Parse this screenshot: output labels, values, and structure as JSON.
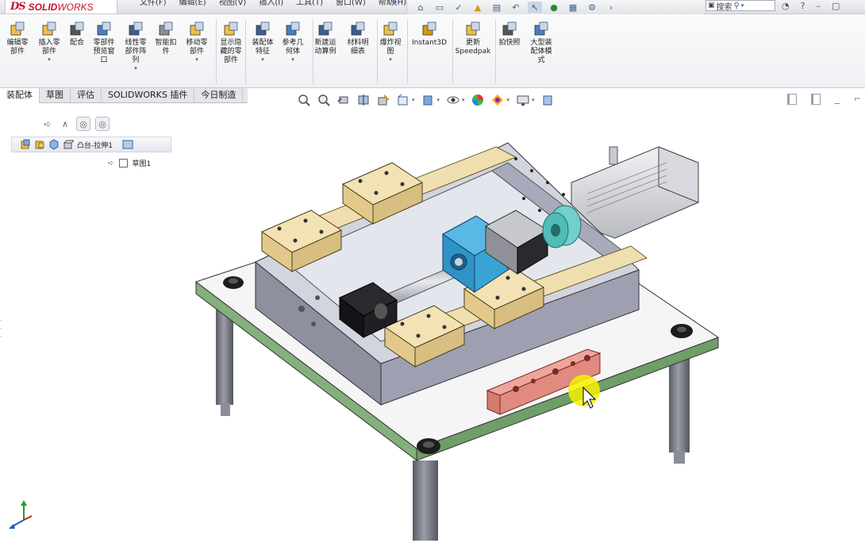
{
  "app": {
    "brand_ds": "DS",
    "brand_name_a": "SOLID",
    "brand_name_b": "WORKS"
  },
  "menu": [
    "文件(F)",
    "编辑(E)",
    "视图(V)",
    "插入(I)",
    "工具(T)",
    "窗口(W)",
    "帮助(H)"
  ],
  "search": {
    "placeholder": "搜索"
  },
  "ribbon": {
    "tools": [
      {
        "name": "edit-component",
        "label": "编辑零\n部件"
      },
      {
        "name": "insert-component",
        "label": "插入零\n部件",
        "dropdown": true
      },
      {
        "name": "mate",
        "label": "配合"
      },
      {
        "name": "component-preview",
        "label": "零部件\n预览窗\n口"
      },
      {
        "name": "linear-pattern",
        "label": "线性零\n部件阵\n列",
        "dropdown": true
      },
      {
        "name": "smart-fasteners",
        "label": "智能扣\n件"
      },
      {
        "name": "move-component",
        "label": "移动零\n部件",
        "dropdown": true
      },
      {
        "name": "show-hidden",
        "label": "显示隐\n藏的零\n部件"
      },
      {
        "name": "assembly-feature",
        "label": "装配体\n特征",
        "dropdown": true
      },
      {
        "name": "reference-geometry",
        "label": "参考几\n何体",
        "dropdown": true
      },
      {
        "name": "new-motion-study",
        "label": "新建运\n动算例"
      },
      {
        "name": "bill-of-materials",
        "label": "材料明\n细表"
      },
      {
        "name": "exploded-view",
        "label": "爆炸视\n图",
        "dropdown": true
      },
      {
        "name": "instant3d",
        "label": "Instant3D"
      },
      {
        "name": "update-speedpak",
        "label": "更新\nSpeedpak"
      },
      {
        "name": "take-snapshot",
        "label": "拍快照"
      },
      {
        "name": "large-assembly-mode",
        "label": "大型装\n配体模\n式"
      }
    ]
  },
  "tabs": [
    {
      "label": "装配体",
      "active": true
    },
    {
      "label": "草图"
    },
    {
      "label": "评估"
    },
    {
      "label": "SOLIDWORKS 插件"
    },
    {
      "label": "今日制造"
    }
  ],
  "breadcrumb": {
    "feature": "凸台-拉伸1",
    "sketch": "草图1"
  },
  "colors": {
    "accent": "#c8102e",
    "plate_top": "#f4f4f4",
    "plate_edge": "#7fae7a",
    "frame": "#cfd1dc",
    "rail_block": "#f0deb0",
    "motor_block": "#3fa7d8",
    "coupling": "#6fd0cc",
    "red_part": "#e08a80",
    "cursor_highlight": "#f6f000"
  }
}
